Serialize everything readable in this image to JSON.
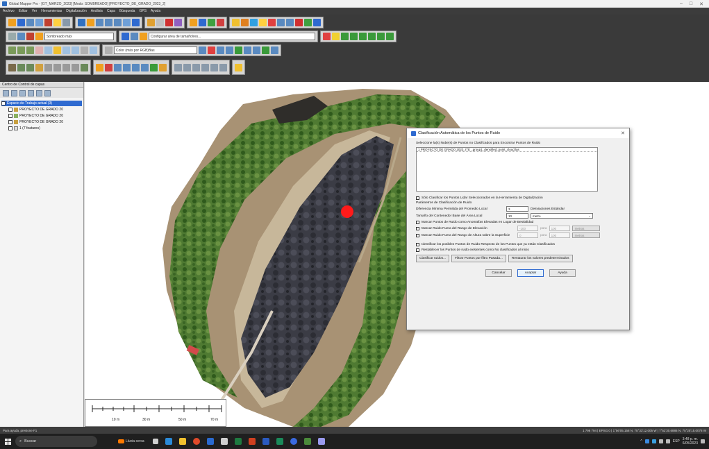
{
  "window": {
    "title": "Global Mapper Pro - [GT_MARZO_2023] [Modo: SOMBREADO] [PROYECTO_DE_GRADO_2023_2]"
  },
  "menu": [
    "Archivo",
    "Editar",
    "Ver",
    "Herramientas",
    "Digitalización",
    "Análisis",
    "Capa",
    "Búsqueda",
    "GPS",
    "Ayuda"
  ],
  "toolbar": {
    "combo1": "Sombreado máx",
    "combo2": "Configurar área de tamaño/res...",
    "combo3": "Color (más por RGB)Bas"
  },
  "layers_panel": {
    "header": "Centro de Control de capas",
    "items": [
      {
        "label": "Espacio de Trabajo actual (3)",
        "selected": true
      },
      {
        "label": "PROYECTO DE GRADO 20",
        "selected": false
      },
      {
        "label": "PROYECTO DE GRADO 20",
        "selected": false
      },
      {
        "label": "PROYECTO DE GRADO 20",
        "selected": false
      },
      {
        "label": "1 (7 features)",
        "selected": false
      }
    ]
  },
  "scalebar": {
    "labels": [
      "10 m",
      "30 m",
      "50 m",
      "70 m"
    ]
  },
  "dialog": {
    "title": "Clasificación Automática de los Puntos de Ruido",
    "list_label": "Seleccione la(s) Nube(s) de Puntos no Clasificados para Encontrar Puntos de Ruido",
    "list_items": [
      "1 PROYECTO DE GRADO 2023_ITE _group1_densified_point_cloud.las"
    ],
    "only_selected": "Sólo Clasificar los Puntos Lidar Seleccionados en la Herramienta de Digitalización",
    "params_label": "Parámetros de Clasificación de Ruido",
    "min_diff_label": "Diferencia Mínima Permitida del Promedio Local",
    "min_diff_value": "3",
    "min_diff_unit": "Desviaciones Estándar",
    "window_label": "Tamaño del Contenedor Base del Área Local",
    "window_value": "10",
    "window_unit": "metro",
    "mark_low_label": "Marcar Puntos de Ruido como Anomalías Elevadas en Lugar de Bestialidad",
    "elev_range_label": "Marcar Ruido Fuera del Rango de Elevación",
    "elev_from": "-100",
    "elev_para": "para",
    "elev_to": "100",
    "elev_unit": "metros",
    "surf_range_label": "Marcar Ruido Fuera del Rango de Altura sobre la Superficie",
    "surf_from": "0",
    "surf_para": "para",
    "surf_to": "100",
    "surf_unit": "metros",
    "identify_label": "Identificar los posibles Puntos de Ruido Respecto de los Puntos que ya están Clasificados",
    "reset_label": "Restablecer los Puntos de ruido existentes como No clasificados al inicio",
    "btn_classify": "Clasificar ruidos...",
    "btn_filter": "Filtrar Puntos por filtro Pasada...",
    "btn_restore": "Restaurar los valores predeterminados",
    "btn_cancel": "Cancelar",
    "btn_accept": "Aceptar",
    "btn_help": "Ayuda"
  },
  "statusbar": {
    "left": "Para ayuda, presione F1",
    "right": "1 796 794 | EPSG:0 | 1°56'05.158 N, 75°33'12.005 W | 7°52'30.6886 N, 75°25'15.0078 W"
  },
  "taskbar": {
    "search_placeholder": "Buscar",
    "weather": "Lluvia cerca",
    "clock_time": "3:48 p. m.",
    "clock_date": "6/05/2023",
    "lang": "ESP"
  },
  "colors": {
    "toolbar_bg": "#3a3a3a",
    "selection": "#2f6ad0",
    "marker": "#ff0000",
    "taskbar": "#1f1f1f"
  }
}
